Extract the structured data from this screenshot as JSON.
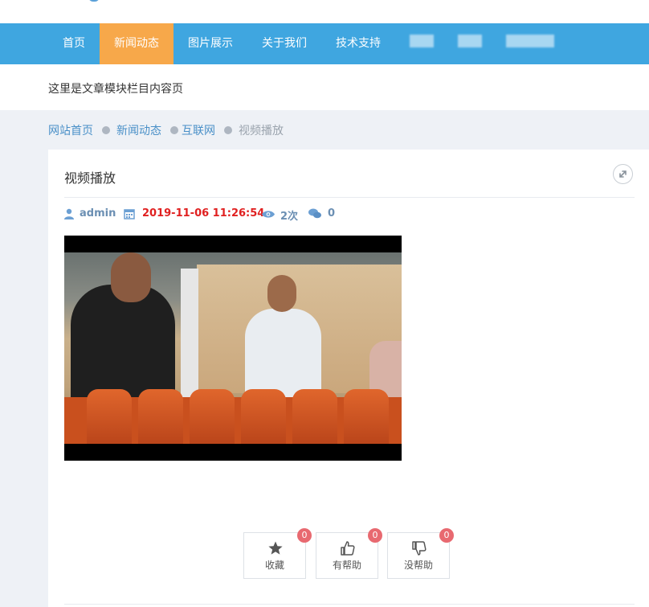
{
  "nav": {
    "items": [
      {
        "label": "首页"
      },
      {
        "label": "新闻动态",
        "active": true
      },
      {
        "label": "图片展示"
      },
      {
        "label": "关于我们"
      },
      {
        "label": "技术支持"
      }
    ]
  },
  "banner": {
    "text": "这里是文章模块栏目内容页"
  },
  "breadcrumb": [
    "网站首页",
    "新闻动态",
    "互联网",
    "视频播放"
  ],
  "article": {
    "title": "视频播放",
    "author": "admin",
    "date": "2019-11-06 11:26:54",
    "views": "2次",
    "comments": "0"
  },
  "actions": [
    {
      "label": "收藏",
      "count": "0",
      "icon": "star-icon"
    },
    {
      "label": "有帮助",
      "count": "0",
      "icon": "thumbs-up-icon"
    },
    {
      "label": "没帮助",
      "count": "0",
      "icon": "thumbs-down-icon"
    }
  ],
  "colors": {
    "nav_bg": "#3fa6e0",
    "nav_active": "#f7a84a",
    "date": "#e02020",
    "meta": "#6b8fb3",
    "badge": "#e86970"
  }
}
